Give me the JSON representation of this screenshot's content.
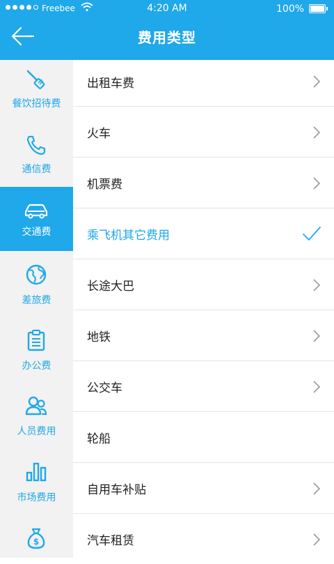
{
  "status_bar": {
    "carrier": "Freebee",
    "time": "4:20 AM",
    "battery": "100%"
  },
  "header": {
    "title": "费用类型",
    "back_icon": "back-arrow-icon"
  },
  "colors": {
    "accent": "#1fa8ea",
    "sidebar_bg": "#f2f2f2",
    "text": "#222222",
    "divider": "#e5e5e5"
  },
  "categories": [
    {
      "label": "餐饮招待费",
      "icon": "spatula-icon",
      "active": false
    },
    {
      "label": "通信费",
      "icon": "phone-icon",
      "active": false
    },
    {
      "label": "交通费",
      "icon": "car-icon",
      "active": true
    },
    {
      "label": "差旅费",
      "icon": "globe-icon",
      "active": false
    },
    {
      "label": "办公费",
      "icon": "clipboard-icon",
      "active": false
    },
    {
      "label": "人员费用",
      "icon": "people-icon",
      "active": false
    },
    {
      "label": "市场费用",
      "icon": "bar-chart-icon",
      "active": false
    },
    {
      "label": "",
      "icon": "money-bag-icon",
      "active": false
    }
  ],
  "items": [
    {
      "label": "出租车费",
      "indicator": "chevron"
    },
    {
      "label": "火车",
      "indicator": "chevron"
    },
    {
      "label": "机票费",
      "indicator": "chevron"
    },
    {
      "label": "乘飞机其它费用",
      "indicator": "check",
      "selected": true
    },
    {
      "label": "长途大巴",
      "indicator": "chevron"
    },
    {
      "label": "地铁",
      "indicator": "chevron"
    },
    {
      "label": "公交车",
      "indicator": "chevron"
    },
    {
      "label": "轮船",
      "indicator": "none"
    },
    {
      "label": "自用车补贴",
      "indicator": "chevron"
    },
    {
      "label": "汽车租赁",
      "indicator": "chevron"
    }
  ]
}
